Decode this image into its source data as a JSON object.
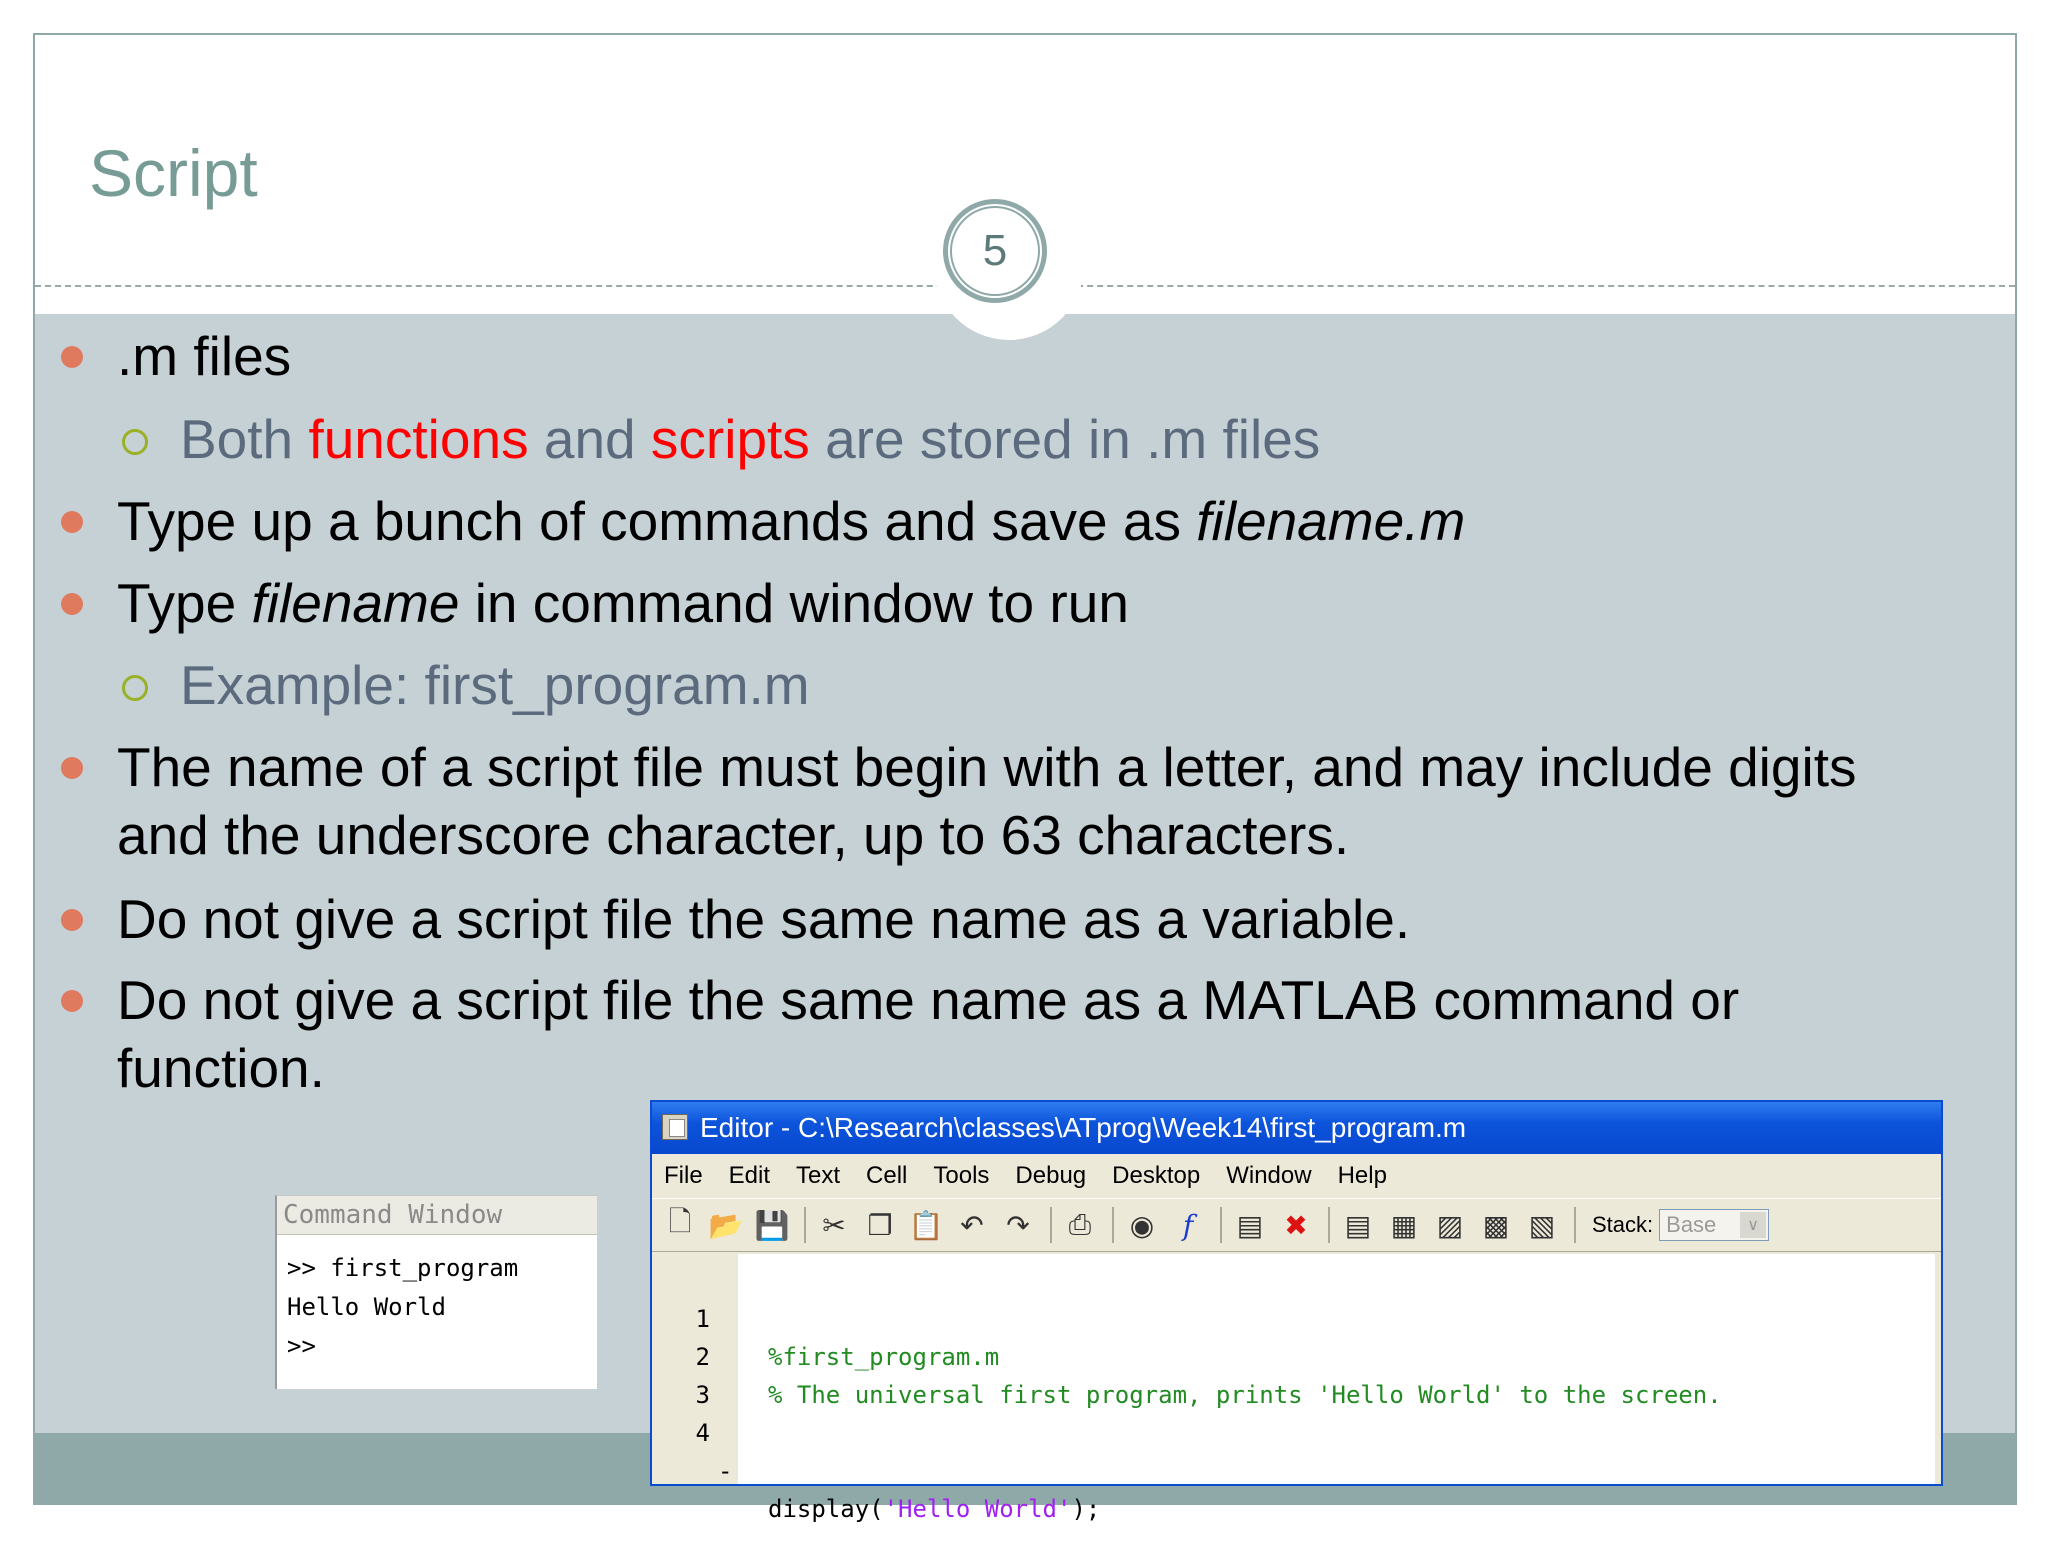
{
  "slide": {
    "title": "Script",
    "slide_number": "5"
  },
  "bullets": [
    {
      "text": ".m files"
    },
    {
      "sub": true,
      "parts": [
        "Both ",
        "functions",
        " and ",
        "scripts",
        " are stored in .m files"
      ]
    },
    {
      "parts": [
        "Type up a bunch of commands and save as ",
        "filename.m"
      ]
    },
    {
      "parts": [
        "Type ",
        "filename",
        " in command window to run"
      ]
    },
    {
      "sub": true,
      "text": "Example: first_program.m"
    },
    {
      "text_line1": "The name of a script file must begin with a letter, and may include digits",
      "text_line2": "and the underscore character, up to 63 characters."
    },
    {
      "text": "Do not give a script file the same name as a variable."
    },
    {
      "text_line1": "Do not give a script file the same name as a MATLAB command or",
      "text_line2": "function."
    }
  ],
  "command_window": {
    "title": "Command Window",
    "lines": [
      ">> first_program",
      "Hello World",
      ">>"
    ]
  },
  "editor": {
    "title": "Editor - C:\\Research\\classes\\ATprog\\Week14\\first_program.m",
    "menu": [
      "File",
      "Edit",
      "Text",
      "Cell",
      "Tools",
      "Debug",
      "Desktop",
      "Window",
      "Help"
    ],
    "stack_label": "Stack:",
    "stack_value": "Base",
    "toolbar_icons": [
      "new-file-icon",
      "open-folder-icon",
      "save-icon",
      "cut-icon",
      "copy-icon",
      "paste-icon",
      "undo-icon",
      "redo-icon",
      "print-icon",
      "find-icon",
      "function-icon",
      "set-breakpoint-icon",
      "clear-breakpoint-icon",
      "step-icon",
      "step-in-icon",
      "step-out-icon",
      "continue-icon",
      "exit-debug-icon"
    ],
    "code": [
      {
        "num": "1",
        "marker": "",
        "comment": "%first_program.m"
      },
      {
        "num": "2",
        "marker": "",
        "comment": "% The universal first program, prints 'Hello World' to the screen."
      },
      {
        "num": "3",
        "marker": "",
        "comment": ""
      },
      {
        "num": "4",
        "marker": "-",
        "code_pre": "display(",
        "string": "'Hello World'",
        "code_post": ");"
      }
    ]
  }
}
